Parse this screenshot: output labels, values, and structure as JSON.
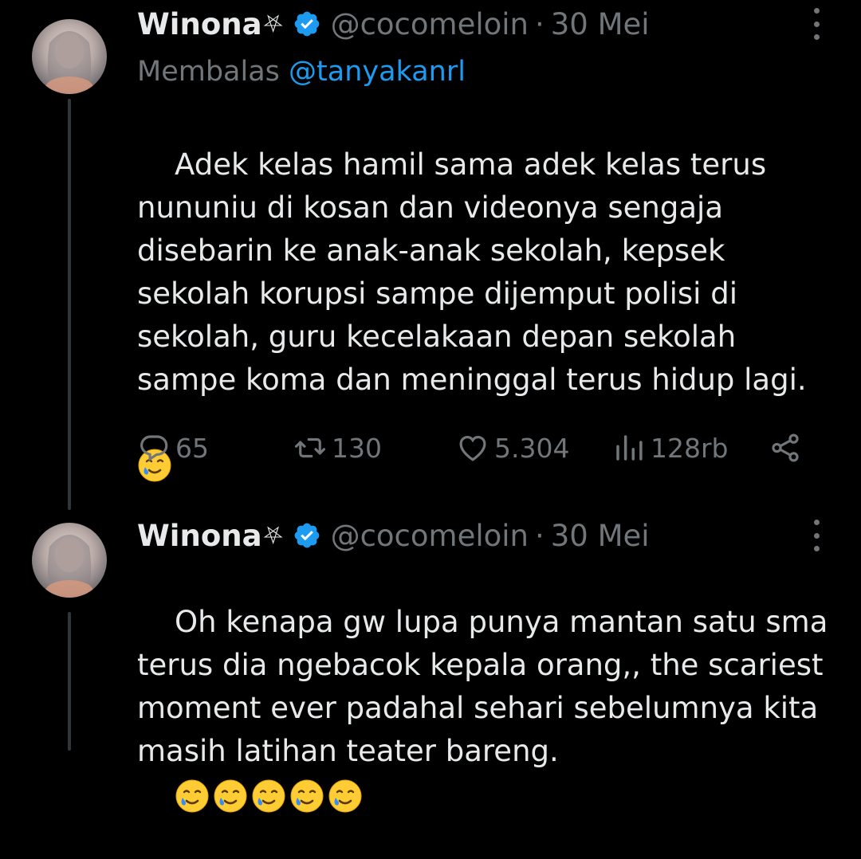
{
  "colors": {
    "background": "#000000",
    "text": "#e7e9ea",
    "muted": "#71767b",
    "accent": "#1d9bf0",
    "thread_line": "#333639"
  },
  "tweets": [
    {
      "author": {
        "name": "Winona",
        "name_symbol": "⛧",
        "verified": true,
        "handle": "@cocomeloin"
      },
      "separator": "·",
      "date": "30 Mei",
      "reply_prefix": "Membalas",
      "reply_to": "@tanyakanrl",
      "text": "Adek kelas hamil sama adek kelas terus nununiu di kosan dan videonya sengaja disebarin ke anak-anak sekolah, kepsek sekolah korupsi sampe dijemput polisi di sekolah, guru kecelakaan depan sekolah sampe koma dan meninggal terus hidup lagi.",
      "emoji": "smiling-face-with-tear",
      "stats": {
        "replies": "65",
        "reposts": "130",
        "likes": "5.304",
        "views": "128rb"
      }
    },
    {
      "author": {
        "name": "Winona",
        "name_symbol": "⛧",
        "verified": true,
        "handle": "@cocomeloin"
      },
      "separator": "·",
      "date": "30 Mei",
      "text": "Oh kenapa gw lupa punya mantan satu sma terus dia ngebacok kepala orang,, the scariest moment ever padahal sehari sebelumnya kita masih latihan teater bareng.",
      "emoji_count": 5
    }
  ]
}
